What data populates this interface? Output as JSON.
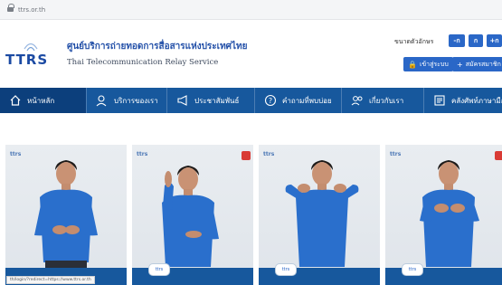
{
  "browser": {
    "url": "ttrs.or.th"
  },
  "header": {
    "logo_text": "TTRS",
    "title_th": "ศูนย์บริการถ่ายทอดการสื่อสารแห่งประเทศไทย",
    "title_en": "Thai Telecommunication Relay Service",
    "font_size_label": "ขนาดตัวอักษร",
    "font_buttons": [
      "-ก",
      "ก",
      "+ก"
    ],
    "login_label": "เข้าสู่ระบบ",
    "register_label": "สมัครสมาชิก"
  },
  "nav": {
    "items": [
      {
        "label": "หน้าหลัก",
        "icon": "home-icon"
      },
      {
        "label": "บริการของเรา",
        "icon": "user-search-icon"
      },
      {
        "label": "ประชาสัมพันธ์",
        "icon": "megaphone-icon"
      },
      {
        "label": "คำถามที่พบบ่อย",
        "icon": "question-icon"
      },
      {
        "label": "เกี่ยวกับเรา",
        "icon": "people-icon"
      },
      {
        "label": "คลังศัพท์ภาษามือ",
        "icon": "book-icon"
      }
    ]
  },
  "cards": [
    {
      "logo": "ttrs",
      "has_flag": false
    },
    {
      "logo": "ttrs",
      "has_flag": true
    },
    {
      "logo": "ttrs",
      "has_flag": false
    },
    {
      "logo": "ttrs",
      "has_flag": true
    }
  ],
  "status_bar": {
    "link": "th/login/?redirect=https://www.ttrs.or.th"
  },
  "colors": {
    "primary": "#17589d",
    "accent": "#2a67c7",
    "active_nav": "#0c3f7c",
    "flag": "#d93b35"
  }
}
